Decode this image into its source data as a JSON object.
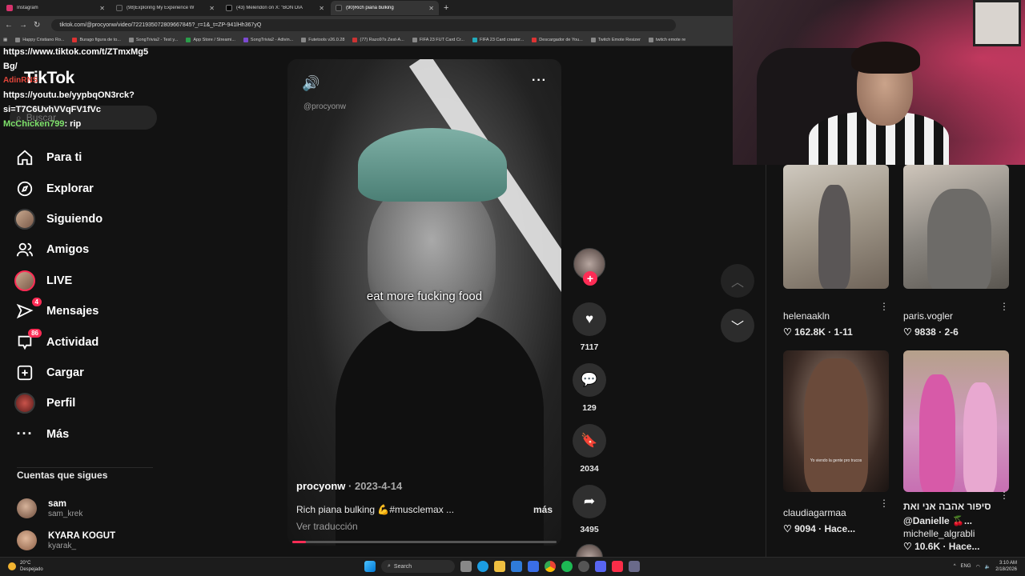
{
  "browser": {
    "tabs": [
      {
        "label": "Instagram",
        "active": false
      },
      {
        "label": "(98)Exploring My Experience W",
        "active": false
      },
      {
        "label": "(43) Melendon on X: \"BON DÍA",
        "active": false
      },
      {
        "label": "(90)Rich piana bulking",
        "active": true
      }
    ],
    "new_tab": "+",
    "url": "tiktok.com/@procyonw/video/7221935072809667845?_r=1&_t=ZP-941lHh367yQ",
    "bookmarks": [
      "Happy Cristiano Ro...",
      "Burago figura de to...",
      "SongTrivia2 - Test y...",
      "App Store / Streami...",
      "SongTrivia2 - Adivin...",
      "Futetools v26.0.28",
      "(77) Razo97s Zest-A...",
      "FIFA 23 FUT Card Cr...",
      "FIFA 23 Card creator...",
      "Descargador de You...",
      "Twitch Emote Resizer",
      "twitch emote re"
    ]
  },
  "chat": {
    "line1": "https://www.tiktok.com/t/ZTmxMg5",
    "line2": "Bg/",
    "user1": "AdinRNS",
    "line3": "https://youtu.be/yypbqON3rck?",
    "line4": "si=T7C6UvhVVqFV1fVc",
    "user2": "McChicken799",
    "msg2": ": rip"
  },
  "sidebar": {
    "logo": "TikTok",
    "search_placeholder": "Buscar",
    "nav": [
      {
        "label": "Para ti",
        "icon": "home-icon"
      },
      {
        "label": "Explorar",
        "icon": "compass-icon"
      },
      {
        "label": "Siguiendo",
        "icon": "avatar"
      },
      {
        "label": "Amigos",
        "icon": "users-icon"
      },
      {
        "label": "LIVE",
        "icon": "avatar"
      },
      {
        "label": "Mensajes",
        "icon": "send-icon",
        "badge": "4"
      },
      {
        "label": "Actividad",
        "icon": "inbox-icon",
        "badge": "86"
      },
      {
        "label": "Cargar",
        "icon": "plus-square-icon"
      },
      {
        "label": "Perfil",
        "icon": "avatar"
      },
      {
        "label": "Más",
        "icon": "ellipsis-icon"
      }
    ],
    "following_title": "Cuentas que sigues",
    "following": [
      {
        "name": "sam",
        "username": "sam_krek"
      },
      {
        "name": "KYARA KOGUT",
        "username": "kyarak_"
      }
    ]
  },
  "video": {
    "watermark": "@procyonw",
    "subtitle": "eat more fucking food",
    "author": "procyonw",
    "date": "· 2023-4-14",
    "description": "Rich piana bulking 💪#musclemax ...",
    "more": "más",
    "translate": "Ver traducción",
    "progress": 0.05
  },
  "actions": {
    "likes": "7117",
    "comments": "129",
    "saves": "2034",
    "shares": "3495"
  },
  "suggested": [
    {
      "name": "helenaakln",
      "stats": "♡ 162.8K · 1-11"
    },
    {
      "name": "paris.vogler",
      "stats": "♡ 9838 · 2-6"
    },
    {
      "name": "claudiagarmaa",
      "stats": "♡ 9094 · Hace...",
      "caption": "Yo viendo la gente pro trucos"
    },
    {
      "name": "סיפור אהבה אני ואת @Danielle 🍒...",
      "username": "michelle_algrabli",
      "stats": "♡ 10.6K · Hace..."
    }
  ],
  "taskbar": {
    "temp": "20°C",
    "weather": "Despejado",
    "search": "Search",
    "lang": "ENG",
    "time": "3:10 AM",
    "date": "2/18/2026"
  }
}
